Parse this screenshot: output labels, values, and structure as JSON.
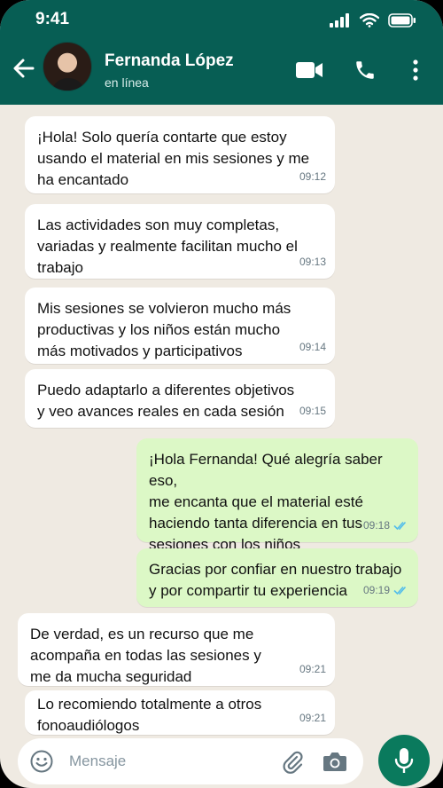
{
  "status": {
    "time": "9:41"
  },
  "header": {
    "contact_name": "Fernanda López",
    "contact_status": "en línea"
  },
  "messages": [
    {
      "direction": "in",
      "text": "¡Hola! Solo quería contarte que estoy\nusando el material en mis sesiones y me\nha encantado",
      "time": "09:12"
    },
    {
      "direction": "in",
      "text": "Las actividades son muy completas,\nvariadas y realmente facilitan mucho el\ntrabajo",
      "time": "09:13"
    },
    {
      "direction": "in",
      "text": "Mis sesiones se volvieron mucho más\nproductivas y los niños están mucho\nmás motivados y participativos",
      "time": "09:14"
    },
    {
      "direction": "in",
      "text": "Puedo adaptarlo a diferentes objetivos\ny veo avances reales en cada sesión",
      "time": "09:15"
    },
    {
      "direction": "out",
      "text": "¡Hola Fernanda! Qué alegría saber eso,\nme encanta que el material esté\nhaciendo tanta diferencia en tus\nsesiones con los niños",
      "time": "09:18",
      "read": true
    },
    {
      "direction": "out",
      "text": "Gracias por confiar en nuestro trabajo\ny por compartir tu experiencia",
      "time": "09:19",
      "read": true
    },
    {
      "direction": "in",
      "text": "De verdad, es un recurso que me\nacompaña en todas las sesiones y\nme da mucha seguridad",
      "time": "09:21"
    },
    {
      "direction": "in",
      "text": "Lo recomiendo totalmente a otros\nfonoaudiólogos",
      "time": "09:21"
    }
  ],
  "composer": {
    "placeholder": "Mensaje"
  },
  "colors": {
    "header": "#075e54",
    "chat_bg": "#efeae2",
    "incoming": "#ffffff",
    "outgoing": "#dcf8c6",
    "mic": "#0a7a5d",
    "read_ticks": "#53bdeb"
  },
  "icons": [
    "back-arrow-icon",
    "video-call-icon",
    "phone-icon",
    "more-vert-icon",
    "emoji-icon",
    "attach-icon",
    "camera-icon",
    "mic-icon"
  ]
}
